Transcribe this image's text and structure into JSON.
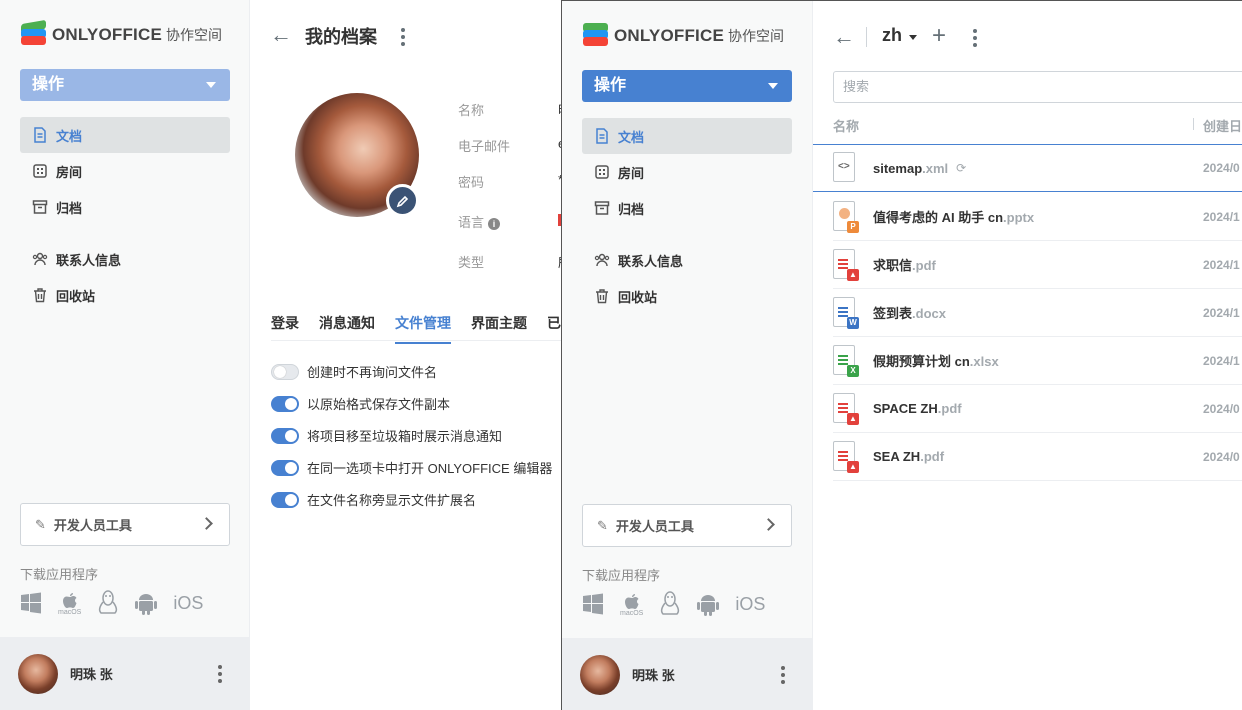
{
  "brand": {
    "name": "ONLYOFFICE",
    "sub": "协作空间"
  },
  "sidebar": {
    "action_label": "操作",
    "items": [
      {
        "label": "文档"
      },
      {
        "label": "房间"
      },
      {
        "label": "归档"
      },
      {
        "label": "联系人信息"
      },
      {
        "label": "回收站"
      }
    ],
    "dev_tools": "开发人员工具",
    "download_label": "下载应用程序",
    "apps": {
      "mac": "macOS",
      "ios": "iOS"
    },
    "user_name": "明珠 张"
  },
  "profile": {
    "title": "我的档案",
    "fields": [
      {
        "label": "名称",
        "value": "明"
      },
      {
        "label": "电子邮件",
        "value": "e"
      },
      {
        "label": "密码",
        "value": "*"
      },
      {
        "label": "语言",
        "value": ""
      },
      {
        "label": "类型",
        "value": "所"
      }
    ],
    "tabs": [
      "登录",
      "消息通知",
      "文件管理",
      "界面主题",
      "已认证"
    ],
    "active_tab": 2,
    "toggles": [
      {
        "label": "创建时不再询问文件名",
        "on": false
      },
      {
        "label": "以原始格式保存文件副本",
        "on": true
      },
      {
        "label": "将项目移至垃圾箱时展示消息通知",
        "on": true
      },
      {
        "label": "在同一选项卡中打开 ONLYOFFICE 编辑器",
        "on": true
      },
      {
        "label": "在文件名称旁显示文件扩展名",
        "on": true
      }
    ]
  },
  "files": {
    "folder": "zh",
    "search_placeholder": "搜索",
    "col_name": "名称",
    "col_created": "创建日",
    "rows": [
      {
        "name": "sitemap",
        "ext": ".xml",
        "date": "2024/0",
        "kind": "xml"
      },
      {
        "name": "值得考虑的 AI 助手 cn",
        "ext": ".pptx",
        "date": "2024/1",
        "kind": "pptx"
      },
      {
        "name": "求职信",
        "ext": ".pdf",
        "date": "2024/1",
        "kind": "pdf"
      },
      {
        "name": "签到表",
        "ext": ".docx",
        "date": "2024/1",
        "kind": "docx"
      },
      {
        "name": "假期预算计划 cn",
        "ext": ".xlsx",
        "date": "2024/1",
        "kind": "xlsx"
      },
      {
        "name": "SPACE ZH",
        "ext": ".pdf",
        "date": "2024/0",
        "kind": "pdf"
      },
      {
        "name": "SEA ZH",
        "ext": ".pdf",
        "date": "2024/0",
        "kind": "pdf"
      }
    ]
  },
  "colors": {
    "accent": "#4781d1",
    "accent_light": "#9ab7e6",
    "pdf": "#e2413c",
    "docx": "#3b74c4",
    "xlsx": "#3aa34a",
    "pptx": "#ee8a3a"
  }
}
